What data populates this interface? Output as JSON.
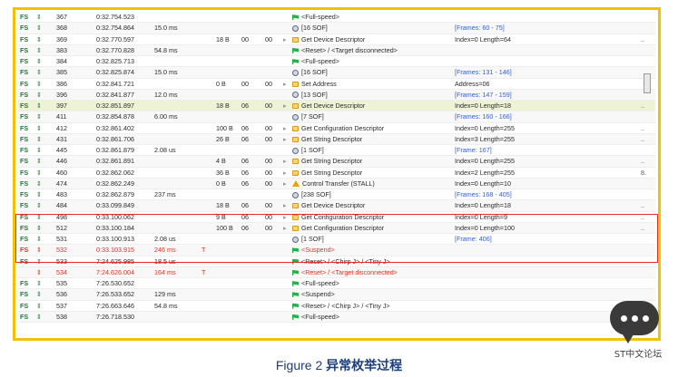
{
  "caption": {
    "label": "Figure 2 ",
    "title": "异常枚举过程"
  },
  "watermark": "ST中文论坛",
  "rows": [
    {
      "speed": "FS",
      "num": "367",
      "time": "0:32.754.523",
      "dur": "",
      "flag": "",
      "len": "",
      "b1": "",
      "b2": "",
      "icon": "flag",
      "desc": "<Full-speed>",
      "info": "",
      "dots": "",
      "style": ""
    },
    {
      "speed": "FS",
      "num": "368",
      "time": "0:32.754.864",
      "dur": "15.0 ms",
      "flag": "",
      "len": "",
      "b1": "",
      "b2": "",
      "icon": "sof",
      "desc": "[16 SOF]",
      "info": "[Frames: 60 - 75]",
      "dots": "",
      "style": "frame"
    },
    {
      "speed": "FS",
      "num": "369",
      "time": "0:32.770.597",
      "dur": "",
      "flag": "",
      "len": "18 B",
      "b1": "00",
      "b2": "00",
      "icon": "xfer",
      "desc": "Get Device Descriptor",
      "info": "Index=0 Length=64",
      "dots": "..",
      "style": ""
    },
    {
      "speed": "FS",
      "num": "383",
      "time": "0:32.770.828",
      "dur": "54.8 ms",
      "flag": "",
      "len": "",
      "b1": "",
      "b2": "",
      "icon": "flag",
      "desc": "<Reset> / <Target disconnected>",
      "info": "",
      "dots": "",
      "style": ""
    },
    {
      "speed": "FS",
      "num": "384",
      "time": "0:32.825.713",
      "dur": "",
      "flag": "",
      "len": "",
      "b1": "",
      "b2": "",
      "icon": "flag",
      "desc": "<Full-speed>",
      "info": "",
      "dots": "",
      "style": ""
    },
    {
      "speed": "FS",
      "num": "385",
      "time": "0:32.825.874",
      "dur": "15.0 ms",
      "flag": "",
      "len": "",
      "b1": "",
      "b2": "",
      "icon": "sof",
      "desc": "[16 SOF]",
      "info": "[Frames: 131 - 146]",
      "dots": "",
      "style": "frame"
    },
    {
      "speed": "FS",
      "num": "386",
      "time": "0:32.841.721",
      "dur": "",
      "flag": "",
      "len": "0 B",
      "b1": "00",
      "b2": "00",
      "icon": "xfer",
      "desc": "Set Address",
      "info": "Address=06",
      "dots": "",
      "style": ""
    },
    {
      "speed": "FS",
      "num": "396",
      "time": "0:32.841.877",
      "dur": "12.0 ms",
      "flag": "",
      "len": "",
      "b1": "",
      "b2": "",
      "icon": "sof",
      "desc": "[13 SOF]",
      "info": "[Frames: 147 - 159]",
      "dots": "",
      "style": "frame"
    },
    {
      "speed": "FS",
      "num": "397",
      "time": "0:32.851.897",
      "dur": "",
      "flag": "",
      "len": "18 B",
      "b1": "06",
      "b2": "00",
      "icon": "xfer",
      "desc": "Get Device Descriptor",
      "info": "Index=0 Length=18",
      "dots": "..",
      "style": "hl"
    },
    {
      "speed": "FS",
      "num": "411",
      "time": "0:32.854.878",
      "dur": "6.00 ms",
      "flag": "",
      "len": "",
      "b1": "",
      "b2": "",
      "icon": "sof",
      "desc": "[7 SOF]",
      "info": "[Frames: 160 - 166]",
      "dots": "",
      "style": "frame"
    },
    {
      "speed": "FS",
      "num": "412",
      "time": "0:32.861.402",
      "dur": "",
      "flag": "",
      "len": "100 B",
      "b1": "06",
      "b2": "00",
      "icon": "xfer",
      "desc": "Get Configuration Descriptor",
      "info": "Index=0 Length=255",
      "dots": "..",
      "style": ""
    },
    {
      "speed": "FS",
      "num": "431",
      "time": "0:32.861.706",
      "dur": "",
      "flag": "",
      "len": "26 B",
      "b1": "06",
      "b2": "00",
      "icon": "xfer",
      "desc": "Get String Descriptor",
      "info": "Index=3 Length=255",
      "dots": "..",
      "style": ""
    },
    {
      "speed": "FS",
      "num": "445",
      "time": "0:32.861.879",
      "dur": "2.08 us",
      "flag": "",
      "len": "",
      "b1": "",
      "b2": "",
      "icon": "sof",
      "desc": "[1 SOF]",
      "info": "[Frame: 167]",
      "dots": "",
      "style": "frame"
    },
    {
      "speed": "FS",
      "num": "446",
      "time": "0:32.861.891",
      "dur": "",
      "flag": "",
      "len": "4 B",
      "b1": "06",
      "b2": "00",
      "icon": "xfer",
      "desc": "Get String Descriptor",
      "info": "Index=0 Length=255",
      "dots": "..",
      "style": ""
    },
    {
      "speed": "FS",
      "num": "460",
      "time": "0:32.862.062",
      "dur": "",
      "flag": "",
      "len": "36 B",
      "b1": "06",
      "b2": "00",
      "icon": "xfer",
      "desc": "Get String Descriptor",
      "info": "Index=2 Length=255",
      "dots": "8.",
      "style": ""
    },
    {
      "speed": "FS",
      "num": "474",
      "time": "0:32.862.249",
      "dur": "",
      "flag": "",
      "len": "0 B",
      "b1": "06",
      "b2": "00",
      "icon": "warn",
      "desc": "Control Transfer (STALL)",
      "info": "Index=0 Length=10",
      "dots": "",
      "style": ""
    },
    {
      "speed": "FS",
      "num": "483",
      "time": "0:32.862.879",
      "dur": "237 ms",
      "flag": "",
      "len": "",
      "b1": "",
      "b2": "",
      "icon": "sof",
      "desc": "[238 SOF]",
      "info": "[Frames: 168 - 405]",
      "dots": "",
      "style": "frame"
    },
    {
      "speed": "FS",
      "num": "484",
      "time": "0:33.099.849",
      "dur": "",
      "flag": "",
      "len": "18 B",
      "b1": "06",
      "b2": "00",
      "icon": "xfer",
      "desc": "Get Device Descriptor",
      "info": "Index=0 Length=18",
      "dots": "..",
      "style": ""
    },
    {
      "speed": "FS",
      "num": "498",
      "time": "0:33.100.062",
      "dur": "",
      "flag": "",
      "len": "9 B",
      "b1": "06",
      "b2": "00",
      "icon": "xfer",
      "desc": "Get Configuration Descriptor",
      "info": "Index=0 Length=9",
      "dots": "..",
      "style": ""
    },
    {
      "speed": "FS",
      "num": "512",
      "time": "0:33.100.184",
      "dur": "",
      "flag": "",
      "len": "100 B",
      "b1": "06",
      "b2": "00",
      "icon": "xfer",
      "desc": "Get Configuration Descriptor",
      "info": "Index=0 Length=100",
      "dots": "..",
      "style": ""
    },
    {
      "speed": "FS",
      "num": "531",
      "time": "0:33.100.913",
      "dur": "2.08 us",
      "flag": "",
      "len": "",
      "b1": "",
      "b2": "",
      "icon": "sof",
      "desc": "[1 SOF]",
      "info": "[Frame: 406]",
      "dots": "",
      "style": "frame"
    },
    {
      "speed": "FS",
      "num": "532",
      "time": "0:33.103.915",
      "dur": "246 ms",
      "flag": "T",
      "len": "",
      "b1": "",
      "b2": "",
      "icon": "flag",
      "desc": "<Suspend>",
      "info": "",
      "dots": "",
      "style": "red"
    },
    {
      "speed": "FS",
      "num": "533",
      "time": "7:24.625.985",
      "dur": "18.5 us",
      "flag": "",
      "len": "",
      "b1": "",
      "b2": "",
      "icon": "flag",
      "desc": "<Reset> / <Chirp J> / <Tiny J>",
      "info": "",
      "dots": "",
      "style": ""
    },
    {
      "speed": "",
      "num": "534",
      "time": "7:24.626.004",
      "dur": "164 ms",
      "flag": "T",
      "len": "",
      "b1": "",
      "b2": "",
      "icon": "flag",
      "desc": "<Reset> / <Target disconnected>",
      "info": "",
      "dots": "",
      "style": "red"
    },
    {
      "speed": "FS",
      "num": "535",
      "time": "7:26.530.652",
      "dur": "",
      "flag": "",
      "len": "",
      "b1": "",
      "b2": "",
      "icon": "flag",
      "desc": "<Full-speed>",
      "info": "",
      "dots": "",
      "style": ""
    },
    {
      "speed": "FS",
      "num": "536",
      "time": "7:26.533.652",
      "dur": "129 ms",
      "flag": "",
      "len": "",
      "b1": "",
      "b2": "",
      "icon": "flag",
      "desc": "<Suspend>",
      "info": "",
      "dots": "",
      "style": ""
    },
    {
      "speed": "FS",
      "num": "537",
      "time": "7:26.663.646",
      "dur": "54.8 ms",
      "flag": "",
      "len": "",
      "b1": "",
      "b2": "",
      "icon": "flag",
      "desc": "<Reset> / <Chirp J> / <Tiny J>",
      "info": "",
      "dots": "",
      "style": ""
    },
    {
      "speed": "FS",
      "num": "538",
      "time": "7:26.718.530",
      "dur": "",
      "flag": "",
      "len": "",
      "b1": "",
      "b2": "",
      "icon": "flag",
      "desc": "<Full-speed>",
      "info": "",
      "dots": "",
      "style": ""
    }
  ]
}
